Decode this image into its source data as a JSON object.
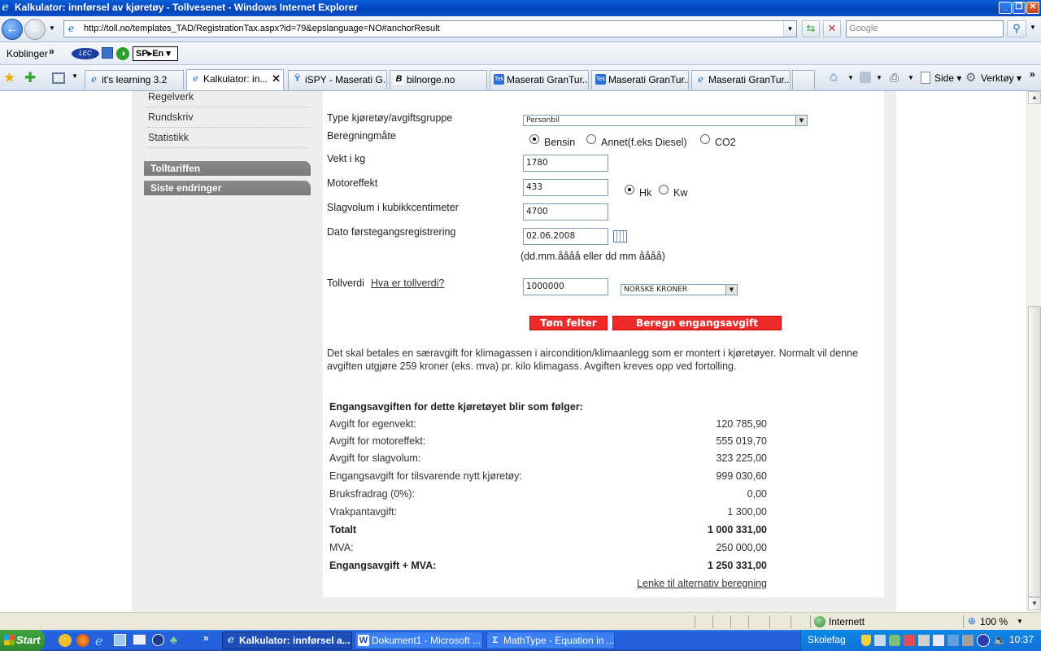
{
  "window": {
    "title": "Kalkulator: innførsel av kjøretøy - Tollvesenet - Windows Internet Explorer"
  },
  "addressbar": {
    "url": "http://toll.no/templates_TAD/RegistrationTax.aspx?id=79&epslanguage=NO#anchorResult",
    "search_placeholder": "Google"
  },
  "linksbar": {
    "label": "Koblinger",
    "chevron": "»",
    "lec": "LEC",
    "translator": "SP▸En"
  },
  "tabs": [
    {
      "label": "it's learning 3.2",
      "icon": "ie-icon"
    },
    {
      "label": "Kalkulator: in...",
      "icon": "ie-icon",
      "active": true
    },
    {
      "label": "iSPY - Maserati G...",
      "icon": "ispy-icon"
    },
    {
      "label": "bilnorge.no",
      "icon": "bilnorge-icon"
    },
    {
      "label": "Maserati GranTur...",
      "icon": "tek-icon"
    },
    {
      "label": "Maserati GranTur...",
      "icon": "tek-icon"
    },
    {
      "label": "Maserati GranTur...",
      "icon": "ie-icon"
    }
  ],
  "commandbar": {
    "page": "Side",
    "tools": "Verktøy"
  },
  "sidebar": {
    "items": [
      "Regelverk",
      "Rundskriv",
      "Statistikk"
    ],
    "headers": [
      "Tolltariffen",
      "Siste endringer"
    ]
  },
  "form": {
    "vehicle_type_label": "Type kjøretøy/avgiftsgruppe",
    "vehicle_type_value": "Personbil",
    "calc_method_label": "Beregningmåte",
    "calc_options": [
      "Bensin",
      "Annet(f.eks Diesel)",
      "CO2"
    ],
    "calc_selected": "Bensin",
    "weight_label": "Vekt i kg",
    "weight_value": "1780",
    "power_label": "Motoreffekt",
    "power_value": "433",
    "power_units": [
      "Hk",
      "Kw"
    ],
    "power_unit_selected": "Hk",
    "displacement_label": "Slagvolum i kubikkcentimeter",
    "displacement_value": "4700",
    "date_label": "Dato førstegangsregistrering",
    "date_value": "02.06.2008",
    "date_hint": "(dd.mm.åååå eller dd mm åååå)",
    "customs_value_label": "Tollverdi",
    "customs_value_help": "Hva er tollverdi?",
    "customs_value": "1000000",
    "currency": "NORSKE KRONER",
    "clear_button": "Tøm felter",
    "calc_button": "Beregn engangsavgift"
  },
  "notice": "Det skal betales en særavgift for klimagassen i aircondition/klimaanlegg som er montert i kjøretøyer. Normalt vil denne avgiften utgjøre 259 kroner (eks. mva) pr. kilo klimagass. Avgiften kreves opp ved fortolling.",
  "result": {
    "heading": "Engangsavgiften for dette kjøretøyet blir som følger:",
    "rows": [
      {
        "label": "Avgift for egenvekt:",
        "value": "120 785,90"
      },
      {
        "label": "Avgift for motoreffekt:",
        "value": "555 019,70"
      },
      {
        "label": "Avgift for slagvolum:",
        "value": "323 225,00"
      },
      {
        "label": "Engangsavgift for tilsvarende nytt kjøretøy:",
        "value": "999 030,60"
      },
      {
        "label": "Bruksfradrag (0%):",
        "value": "0,00"
      },
      {
        "label": "Vrakpantavgift:",
        "value": "1 300,00"
      },
      {
        "label": "Totalt",
        "value": "1 000 331,00",
        "bold": true
      },
      {
        "label": "MVA:",
        "value": "250 000,00"
      },
      {
        "label": "Engangsavgift + MVA:",
        "value": "1 250 331,00",
        "bold": true
      }
    ],
    "alt_link": "Lenke til alternativ beregning"
  },
  "statusbar": {
    "zone": "Internett",
    "zoom": "100 %"
  },
  "taskbar": {
    "start": "Start",
    "tasks": [
      {
        "label": "Kalkulator: innførsel a...",
        "active": true
      },
      {
        "label": "Dokument1 - Microsoft ..."
      },
      {
        "label": "MathType - Equation in ..."
      }
    ],
    "tray_label": "Skolefag",
    "clock": "10:37"
  },
  "colors": {
    "red_button": "#ef2a2a",
    "sidebar_header": "#808080",
    "panel_gray": "#eeeeee",
    "taskbar_blue": "#245edc"
  }
}
